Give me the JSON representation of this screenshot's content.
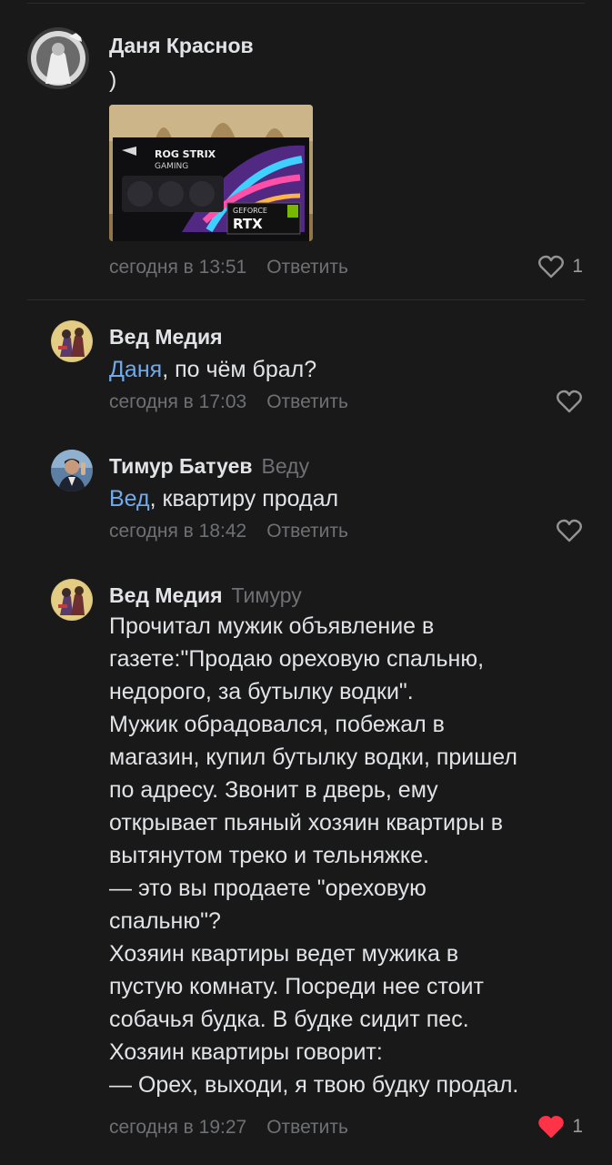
{
  "comments": [
    {
      "author": "Даня Краснов",
      "reply_to": "",
      "mention": "",
      "text": ")",
      "time": "сегодня в 13:51",
      "reply_label": "Ответить",
      "likes": "1",
      "liked": false,
      "photo_texts": [
        "ROG STRIX",
        "GAMING",
        "GEFORCE",
        "RTX"
      ]
    },
    {
      "author": "Вед Медия",
      "reply_to": "",
      "mention": "Даня",
      "text": ", по чём брал?",
      "time": "сегодня в 17:03",
      "reply_label": "Ответить",
      "likes": "",
      "liked": false
    },
    {
      "author": "Тимур Батуев",
      "reply_to": "Веду",
      "mention": "Вед",
      "text": ", квартиру продал",
      "time": "сегодня в 18:42",
      "reply_label": "Ответить",
      "likes": "",
      "liked": false
    },
    {
      "author": "Вед Медия",
      "reply_to": "Тимуру",
      "mention": "",
      "lines": [
        "Прочитал мужик объявление в",
        "газете:\"Продаю ореховую спальню,",
        "недорого, за бутылку водки\".",
        "Мужик обрадовался, побежал в",
        "магазин, купил бутылку водки, пришел",
        "по адресу. Звонит в дверь, ему",
        "открывает пьяный хозяин квартиры в",
        "вытянутом треко и тельняжке.",
        "— это вы продаете \"ореховую",
        "спальню\"?",
        "Хозяин квартиры ведет мужика в",
        "пустую комнату. Посреди нее стоит",
        "собачья будка. В будке сидит пес.",
        "Хозяин квартиры говорит:",
        "— Орех, выходи, я твою будку продал."
      ],
      "time": "сегодня в 19:27",
      "reply_label": "Ответить",
      "likes": "1",
      "liked": true
    }
  ],
  "colors": {
    "background": "#191919",
    "text": "#e1e3e6",
    "secondary": "#6f7073",
    "mention": "#71aaeb",
    "liked": "#ff3347"
  }
}
